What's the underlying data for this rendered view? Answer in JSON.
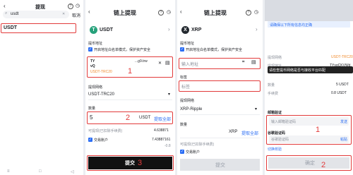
{
  "screen1": {
    "back": "‹",
    "title": "提现",
    "search_value": "usdt",
    "cancel": "取消",
    "result": "USDT"
  },
  "screen2": {
    "back": "‹",
    "title": "链上提现",
    "coin_icon": "T",
    "coin_name": "USDT",
    "coin_color": "#26a17b",
    "addr_label": "提币地址",
    "whitelist_toggle": "开启地址白名单模式，保护资产安全",
    "addr_line1": "TY",
    "addr_line1_tail": "...g9.trw",
    "addr_line2": "vQ",
    "addr_tag": "USDT-TRC20",
    "annot_1": "1",
    "network_label": "提现网络",
    "network_value": "USDT-TRC20",
    "amount_label": "数量",
    "amount_value": "5",
    "amount_unit": "USDT",
    "withdraw_all": "提取全部",
    "annot_2": "2",
    "available_label": "可提现(已扣除手续费)",
    "available_value": "4.638871",
    "account_label": "交易账户",
    "account_value": "7.43887161",
    "sub_value": "-0.8",
    "submit": "提交",
    "annot_3": "3"
  },
  "screen3": {
    "back": "‹",
    "title": "链上提现",
    "coin_icon": "X",
    "coin_name": "XRP",
    "coin_color": "#23292f",
    "addr_label": "提币地址",
    "whitelist_toggle": "开启地址白名单模式，保护资产安全",
    "addr_placeholder": "输入地址",
    "tag_label": "标签",
    "tag_placeholder": "标签",
    "network_label": "提现网络",
    "network_value": "XRP-Ripple",
    "amount_label": "数量",
    "amount_unit": "XRP",
    "withdraw_all": "提取全部",
    "available_label": "可提现(已扣除手续费)",
    "account_label": "交易账户",
    "submit": "提交"
  },
  "screen4": {
    "banner": "请确保以下所有信息均正确",
    "network_label": "提现网络",
    "network_value": "USDT-TRC20",
    "addr_label": "提现地址",
    "addr_value": "TYsgCKVWd",
    "popup": "请检查提币网络是否与接收平台匹配",
    "amount_label": "数量",
    "amount_value": "5 USDT",
    "fee_label": "手续费",
    "fee_value": "0.8 USDT",
    "email_section": "邮箱验证",
    "email_placeholder": "输入邮箱验证码",
    "email_send": "发送",
    "annot_1": "1",
    "google_section": "谷歌验证码",
    "google_placeholder": "谷歌验证码",
    "google_paste": "粘贴",
    "switch_link": "切换校验",
    "confirm": "确定",
    "annot_2": "2"
  },
  "icons": {
    "clock": "◷",
    "help": "?",
    "scan": "⌗",
    "book": "▤",
    "search": "⌕",
    "clear": "✕",
    "check": "✓",
    "close": "✕",
    "chevron": "›",
    "caret": "▾"
  }
}
